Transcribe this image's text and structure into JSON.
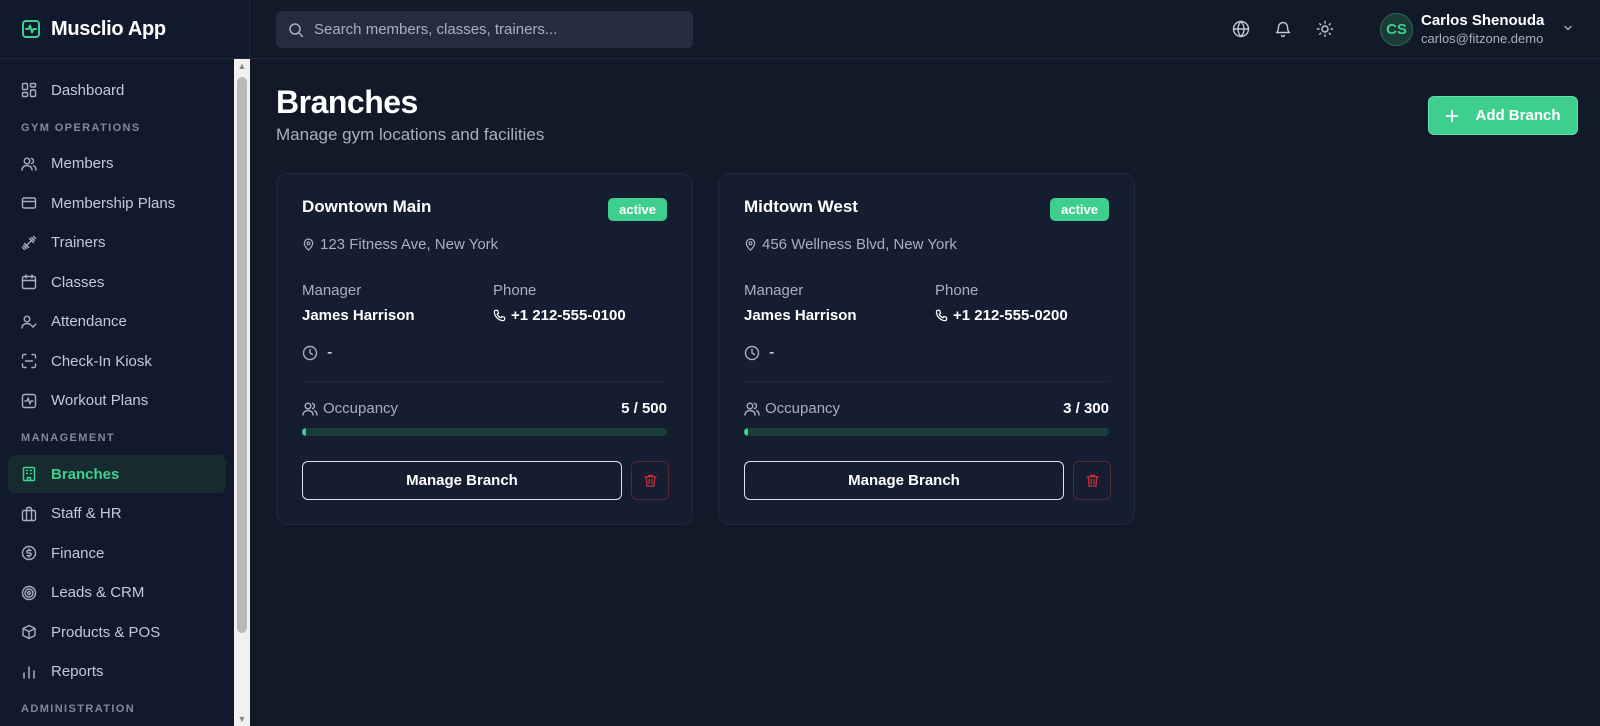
{
  "app": {
    "title": "Musclio App"
  },
  "colors": {
    "accent": "#3ecf8e",
    "background": "#121a2a",
    "sidebar": "#111a2c",
    "danger": "#c0313d"
  },
  "search": {
    "placeholder": "Search members, classes, trainers..."
  },
  "user": {
    "initials": "CS",
    "name": "Carlos Shenouda",
    "email": "carlos@fitzone.demo"
  },
  "sidebar": {
    "items": [
      {
        "label": "Dashboard",
        "icon": "dashboard-icon"
      },
      {
        "label": "Members",
        "icon": "users-icon"
      },
      {
        "label": "Membership Plans",
        "icon": "credit-card-icon"
      },
      {
        "label": "Trainers",
        "icon": "dumbbell-icon"
      },
      {
        "label": "Classes",
        "icon": "calendar-icon"
      },
      {
        "label": "Attendance",
        "icon": "user-check-icon"
      },
      {
        "label": "Check-In Kiosk",
        "icon": "scan-icon"
      },
      {
        "label": "Workout Plans",
        "icon": "activity-icon"
      },
      {
        "label": "Branches",
        "icon": "building-icon",
        "active": true
      },
      {
        "label": "Staff & HR",
        "icon": "briefcase-icon"
      },
      {
        "label": "Finance",
        "icon": "dollar-icon"
      },
      {
        "label": "Leads & CRM",
        "icon": "target-icon"
      },
      {
        "label": "Products & POS",
        "icon": "package-icon"
      },
      {
        "label": "Reports",
        "icon": "bar-chart-icon"
      }
    ],
    "sections": [
      "GYM OPERATIONS",
      "MANAGEMENT",
      "ADMINISTRATION"
    ]
  },
  "page": {
    "title": "Branches",
    "subtitle": "Manage gym locations and facilities",
    "add_button": "Add Branch"
  },
  "branches": [
    {
      "name": "Downtown Main",
      "status": "active",
      "address": "123 Fitness Ave, New York",
      "manager_label": "Manager",
      "manager": "James Harrison",
      "phone_label": "Phone",
      "phone": "+1 212-555-0100",
      "hours": "-",
      "occupancy_label": "Occupancy",
      "occupancy_text": "5 / 500",
      "occupancy_fraction": 0.01,
      "manage_label": "Manage Branch"
    },
    {
      "name": "Midtown West",
      "status": "active",
      "address": "456 Wellness Blvd, New York",
      "manager_label": "Manager",
      "manager": "James Harrison",
      "phone_label": "Phone",
      "phone": "+1 212-555-0200",
      "hours": "-",
      "occupancy_label": "Occupancy",
      "occupancy_text": "3 / 300",
      "occupancy_fraction": 0.01,
      "manage_label": "Manage Branch"
    }
  ]
}
